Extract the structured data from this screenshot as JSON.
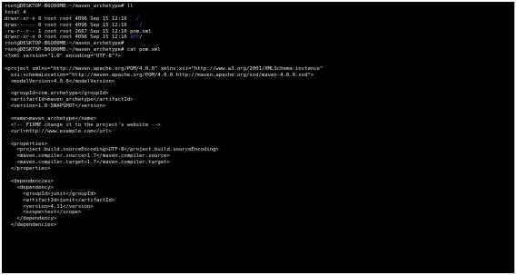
{
  "terminal": {
    "colors": {
      "background": "#000000",
      "foreground": "#e8e8e8",
      "directory": "#5c6cff"
    },
    "lines": [
      [
        {
          "t": "root@DESKTOP-B6Q00MB:~/maven_archetype# ll",
          "c": "prompt"
        }
      ],
      [
        {
          "t": "total 4"
        }
      ],
      [
        {
          "t": "drwxr-xr-x 0 root root 4096 Sep 15 12:16  "
        },
        {
          "t": "./",
          "c": "dir"
        }
      ],
      [
        {
          "t": "drwx------ 0 root root 4096 Sep 15 12:16  "
        },
        {
          "t": "../",
          "c": "dir"
        }
      ],
      [
        {
          "t": "-rw-r--r-- 1 root root 2667 Sep 15 12:16 pom.xml"
        }
      ],
      [
        {
          "t": "drwxr-xr-x 0 root root 4096 Sep 15 12:16 "
        },
        {
          "t": "src",
          "c": "dir"
        },
        {
          "t": "/"
        }
      ],
      [
        {
          "t": "root@DESKTOP-B6Q00MB:~/maven_archetype#",
          "c": "prompt"
        }
      ],
      [
        {
          "t": "root@DESKTOP-B6Q00MB:~/maven_archetype# cat pom.xml",
          "c": "prompt"
        }
      ],
      [
        {
          "t": "<?xml version=\"1.0\" encoding=\"UTF-8\"?>"
        }
      ],
      [
        {
          "t": ""
        }
      ],
      [
        {
          "t": "<project xmlns=\"http://maven.apache.org/POM/4.0.0\" xmlns:xsi=\"http://www.w3.org/2001/XMLSchema-instance\""
        }
      ],
      [
        {
          "t": "  xsi:schemaLocation=\"http://maven.apache.org/POM/4.0.0 http://maven.apache.org/xsd/maven-4.0.0.xsd\">"
        }
      ],
      [
        {
          "t": "  <modelVersion>4.0.0</modelVersion>"
        }
      ],
      [
        {
          "t": ""
        }
      ],
      [
        {
          "t": "  <groupId>com.archetype</groupId>"
        }
      ],
      [
        {
          "t": "  <artifactId>maven_archetype</artifactId>"
        }
      ],
      [
        {
          "t": "  <version>1.0-SNAPSHOT</version>"
        }
      ],
      [
        {
          "t": ""
        }
      ],
      [
        {
          "t": "  <name>maven_archetype</name>"
        }
      ],
      [
        {
          "t": "  <!-- FIXME change it to the project's website -->"
        }
      ],
      [
        {
          "t": "  <url>http://www.example.com</url>"
        }
      ],
      [
        {
          "t": ""
        }
      ],
      [
        {
          "t": "  <properties>"
        }
      ],
      [
        {
          "t": "    <project.build.sourceEncoding>UTF-8</project.build.sourceEncoding>"
        }
      ],
      [
        {
          "t": "    <maven.compiler.source>1.7</maven.compiler.source>"
        }
      ],
      [
        {
          "t": "    <maven.compiler.target>1.7</maven.compiler.target>"
        }
      ],
      [
        {
          "t": "  </properties>"
        }
      ],
      [
        {
          "t": ""
        }
      ],
      [
        {
          "t": "  <dependencies>"
        }
      ],
      [
        {
          "t": "    <dependency>"
        }
      ],
      [
        {
          "t": "      <groupId>junit</groupId>"
        }
      ],
      [
        {
          "t": "      <artifactId>junit</artifactId>"
        }
      ],
      [
        {
          "t": "      <version>4.11</version>"
        }
      ],
      [
        {
          "t": "      <scope>test</scope>"
        }
      ],
      [
        {
          "t": "    </dependency>"
        }
      ],
      [
        {
          "t": "  </dependencies>"
        }
      ]
    ]
  }
}
